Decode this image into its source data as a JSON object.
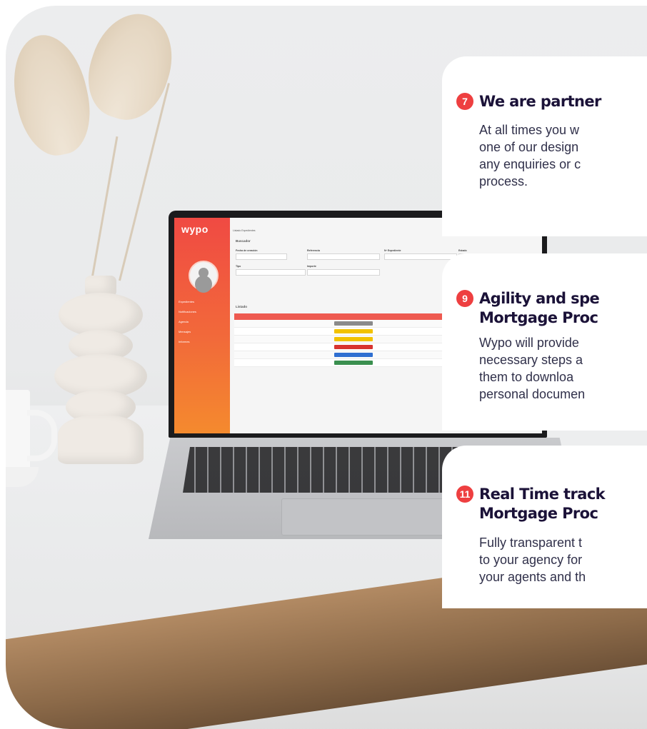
{
  "app_screen": {
    "logo": "wypo",
    "nav_items": [
      "Expedientes",
      "Notificaciones",
      "Agenda",
      "Mensajes",
      "Informes"
    ],
    "breadcrumb": "Listado Expedientes",
    "search_title": "Buscador",
    "fields": {
      "creation_date_label": "Fecha de creación",
      "reference_label": "Referencia",
      "file_no_label": "Nº Expediente",
      "status_label": "Estado",
      "type_label": "Tipo",
      "amount_label": "Importe"
    },
    "list_title": "Listado",
    "table_headers": [
      "Cliente",
      "Estado",
      "Tipo",
      "Localidad"
    ],
    "status_colors": [
      "#8a8a8a",
      "#f2c200",
      "#f2c200",
      "#d8342f",
      "#2f6fd1",
      "#3a8f4f"
    ]
  },
  "cards": [
    {
      "badge": "7",
      "title": "We are partner",
      "lines": [
        "At all times you w",
        "one of our design",
        "any enquiries or c",
        "process."
      ]
    },
    {
      "badge": "9",
      "title_lines": [
        "Agility and spe",
        "Mortgage Proc"
      ],
      "lines": [
        "Wypo will provide",
        "necessary steps a",
        "them to downloa",
        "personal documen"
      ]
    },
    {
      "badge": "11",
      "title_lines": [
        "Real Time track",
        "Mortgage Proc"
      ],
      "lines": [
        "Fully transparent t",
        "to your agency for",
        "your agents and th"
      ]
    }
  ],
  "colors": {
    "badge": "#ee3f40",
    "title": "#1b1238",
    "app_sidebar": "#f04a43"
  }
}
